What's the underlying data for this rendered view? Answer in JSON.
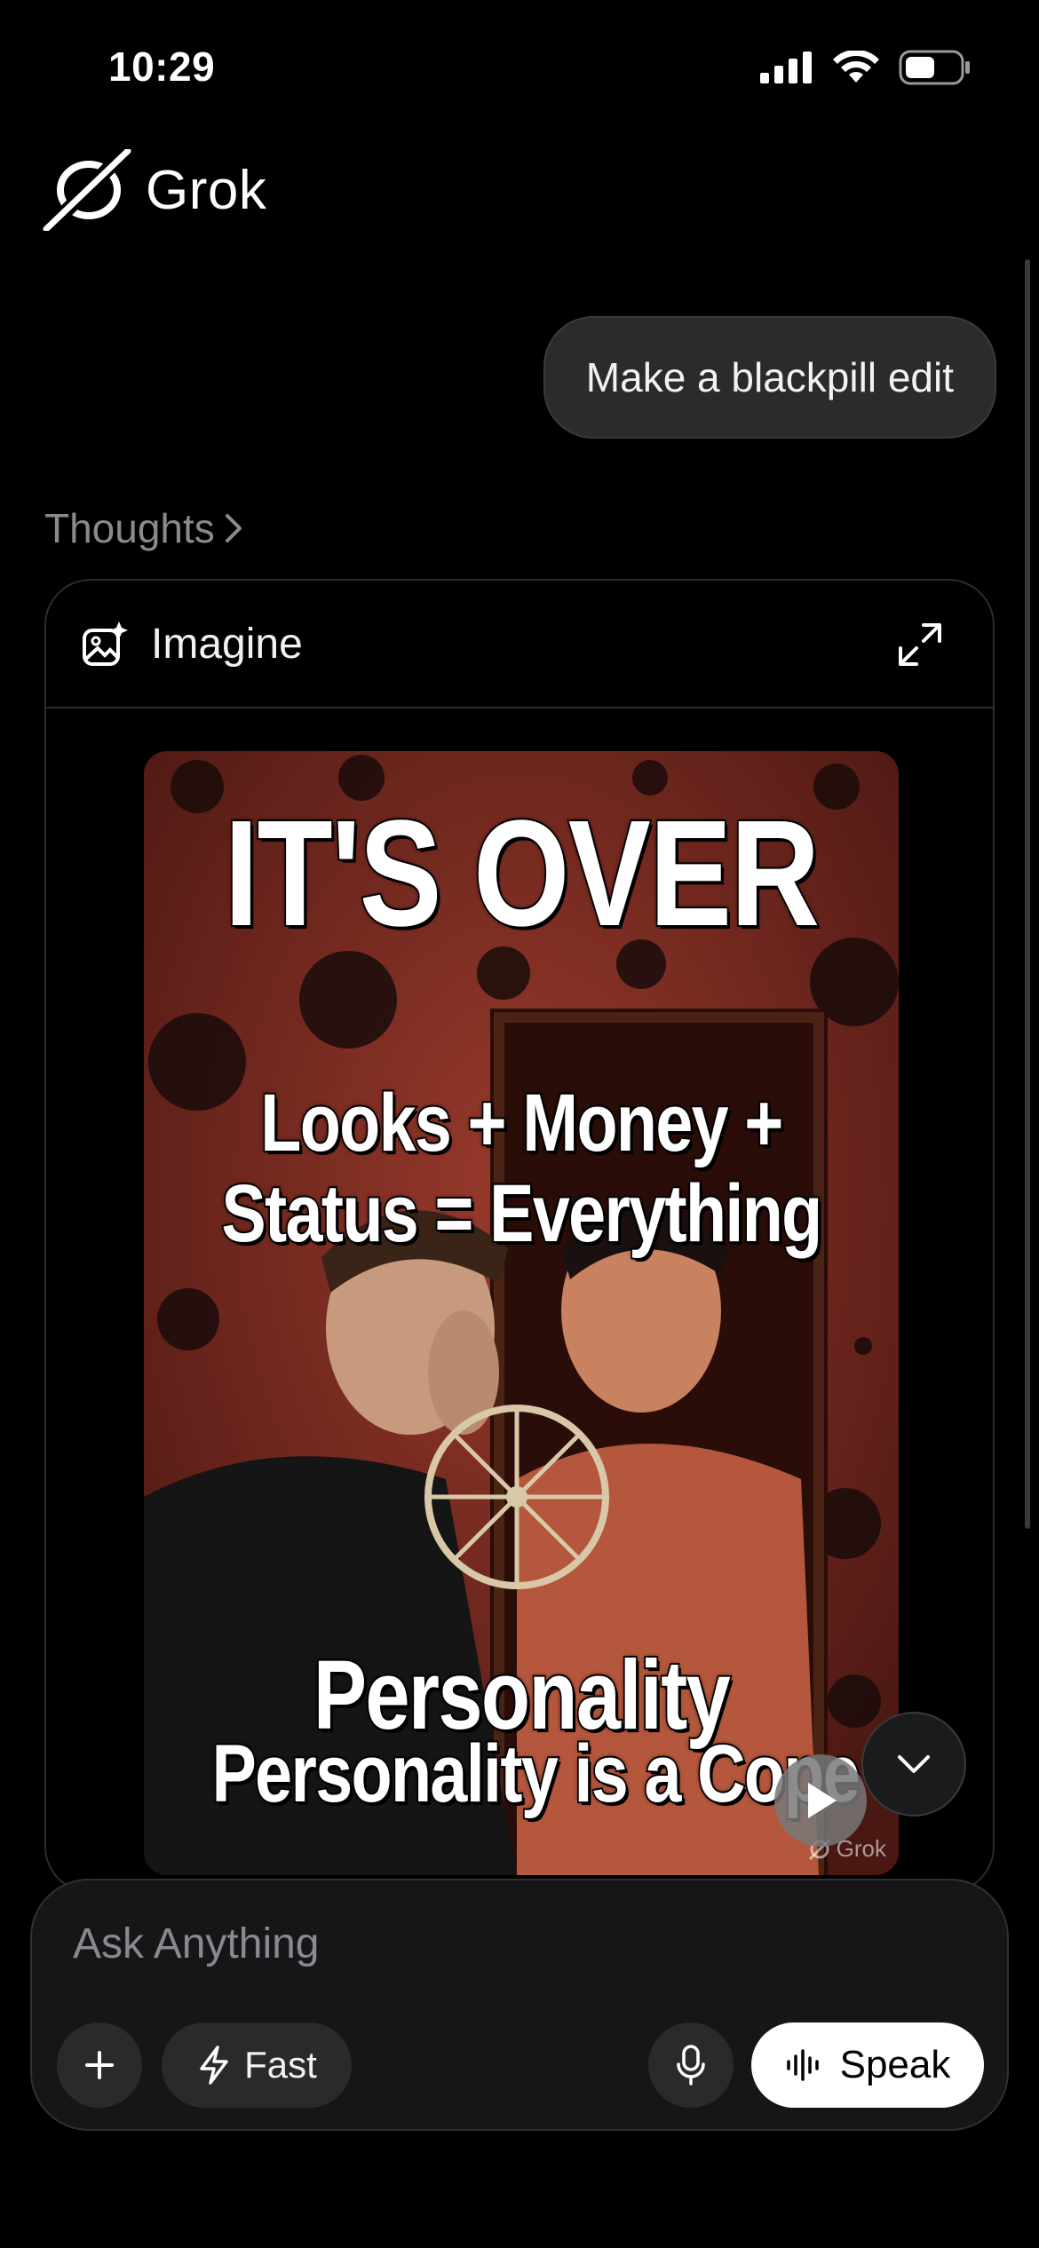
{
  "status_bar": {
    "time": "10:29"
  },
  "app": {
    "name": "Grok"
  },
  "conversation": {
    "user_message": "Make a blackpill edit",
    "thoughts_label": "Thoughts",
    "card": {
      "title": "Imagine",
      "image": {
        "line1": "IT'S OVER",
        "line2": "Looks + Money +",
        "line3": "Status = Everything",
        "line4": "Personality",
        "line5": "Personality is a Cope",
        "watermark": "Grok"
      }
    }
  },
  "composer": {
    "placeholder": "Ask Anything",
    "mode_label": "Fast",
    "speak_label": "Speak"
  },
  "colors": {
    "background": "#000000",
    "bubble": "#2b2b2d",
    "image_bg": "#7a2a22"
  }
}
